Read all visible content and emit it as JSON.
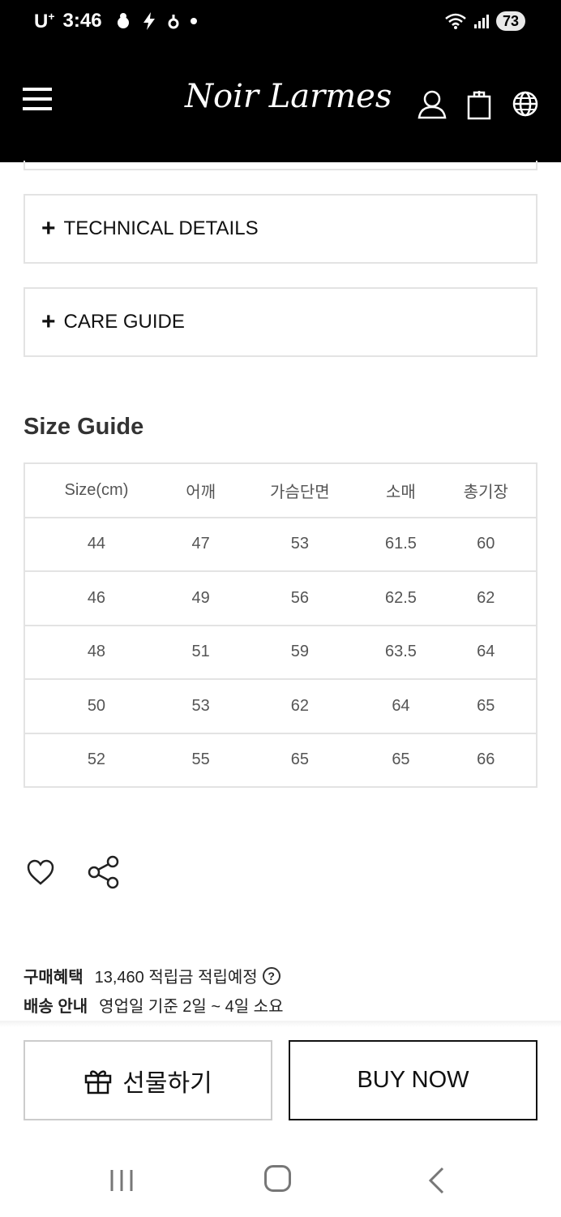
{
  "status_bar": {
    "carrier": "U",
    "carrier_sup": "+",
    "time": "3:46",
    "battery": "73"
  },
  "header": {
    "logo": "Noir Larmes"
  },
  "accordions": [
    {
      "label": "TECHNICAL DETAILS",
      "icon": "plus-icon"
    },
    {
      "label": "CARE GUIDE",
      "icon": "plus-icon"
    }
  ],
  "size_guide": {
    "title": "Size Guide",
    "headers": [
      "Size(cm)",
      "어깨",
      "가슴단면",
      "소매",
      "총기장"
    ],
    "rows": [
      [
        "44",
        "47",
        "53",
        "61.5",
        "60"
      ],
      [
        "46",
        "49",
        "56",
        "62.5",
        "62"
      ],
      [
        "48",
        "51",
        "59",
        "63.5",
        "64"
      ],
      [
        "50",
        "53",
        "62",
        "64",
        "65"
      ],
      [
        "52",
        "55",
        "65",
        "65",
        "66"
      ]
    ]
  },
  "purchase_info": {
    "benefit_label": "구매혜택",
    "benefit_value": "13,460 적립금 적립예정",
    "benefit_help_icon": "?",
    "shipping_label": "배송 안내",
    "shipping_value": "영업일 기준 2일 ~ 4일 소요"
  },
  "actions": {
    "gift_label": "선물하기",
    "buy_label": "BUY NOW"
  }
}
